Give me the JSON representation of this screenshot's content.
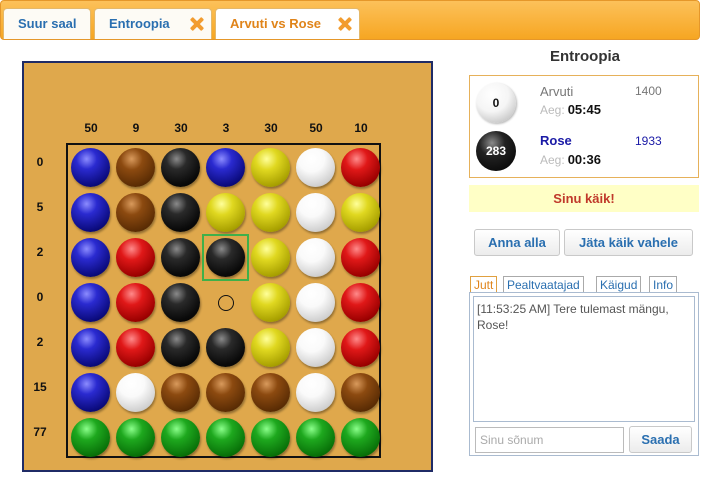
{
  "tabs": [
    {
      "label": "Suur saal"
    },
    {
      "label": "Entroopia"
    },
    {
      "label": "Arvuti vs Rose"
    }
  ],
  "board": {
    "column_scores": [
      "50",
      "9",
      "30",
      "3",
      "30",
      "50",
      "10"
    ],
    "row_scores": [
      "0",
      "5",
      "2",
      "0",
      "2",
      "15",
      "77"
    ],
    "cells": [
      [
        "blue",
        "brown",
        "black",
        "blue",
        "yellow",
        "white",
        "red"
      ],
      [
        "blue",
        "brown",
        "black",
        "yellow",
        "yellow",
        "white",
        "yellow"
      ],
      [
        "blue",
        "red",
        "black",
        "black",
        "yellow",
        "white",
        "red"
      ],
      [
        "blue",
        "red",
        "black",
        "empty",
        "yellow",
        "white",
        "red"
      ],
      [
        "blue",
        "red",
        "black",
        "black",
        "yellow",
        "white",
        "red"
      ],
      [
        "blue",
        "white",
        "brown",
        "brown",
        "brown",
        "white",
        "brown"
      ],
      [
        "green",
        "green",
        "green",
        "green",
        "green",
        "green",
        "green"
      ]
    ],
    "selected": {
      "row": 2,
      "col": 3
    },
    "colors": {
      "selection": "#3fb04a",
      "board": "#dfa84c"
    }
  },
  "game_title": "Entroopia",
  "players": [
    {
      "name": "Arvuti",
      "rating": "1400",
      "score": "0",
      "time_label": "Aeg:",
      "time": "05:45",
      "ball": "white"
    },
    {
      "name": "Rose",
      "rating": "1933",
      "score": "283",
      "time_label": "Aeg:",
      "time": "00:36",
      "ball": "black"
    }
  ],
  "turn_message": "Sinu käik!",
  "buttons": {
    "resign": "Anna alla",
    "pass": "Jäta käik vahele",
    "send": "Saada"
  },
  "chat": {
    "tabs": [
      "Jutt",
      "Pealtvaatajad",
      "Käigud",
      "Info"
    ],
    "messages": [
      "[11:53:25 AM] Tere tulemast mängu, Rose!"
    ],
    "input_placeholder": "Sinu sõnum"
  }
}
